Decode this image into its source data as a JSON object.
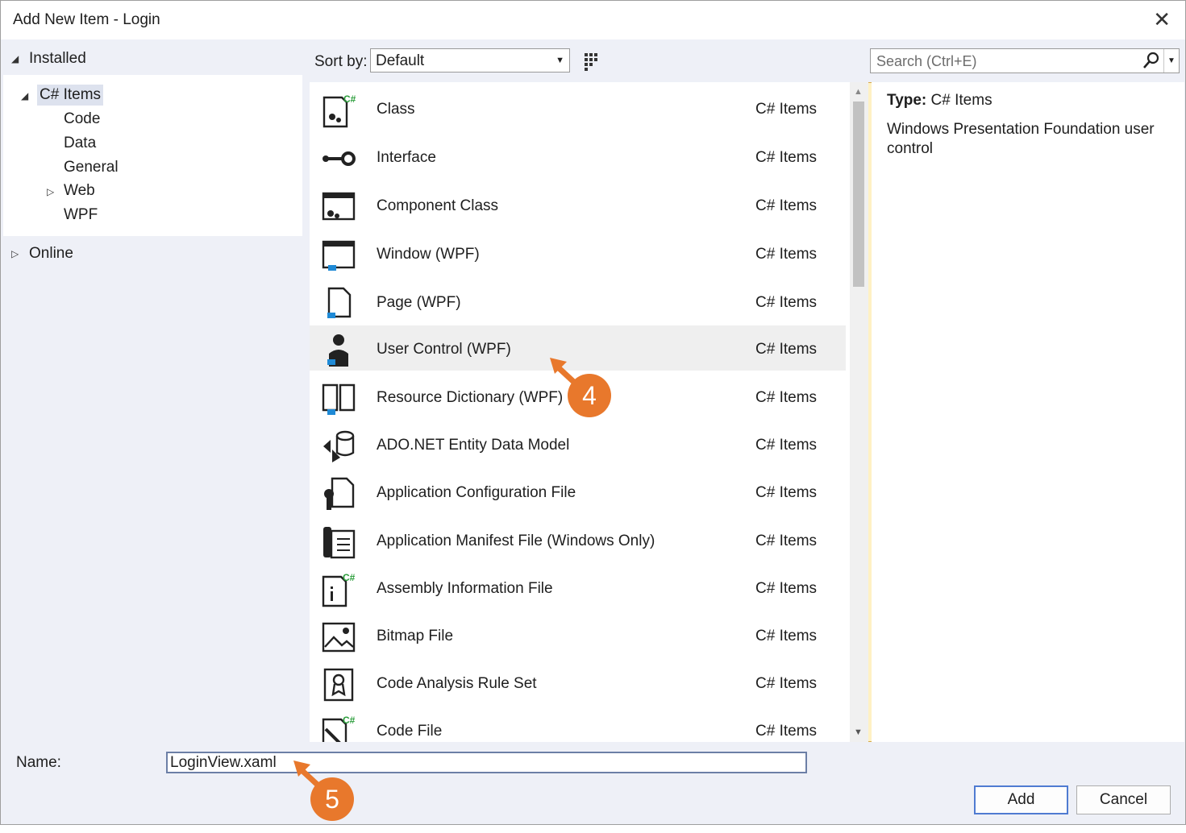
{
  "window": {
    "title": "Add New Item - Login",
    "close_glyph": "✕"
  },
  "tree": {
    "installed": "Installed",
    "csharp_items": "C# Items",
    "children": [
      "Code",
      "Data",
      "General",
      "Web",
      "WPF"
    ],
    "online": "Online"
  },
  "toolbar": {
    "sort_label": "Sort by:",
    "sort_value": "Default",
    "search_placeholder": "Search (Ctrl+E)"
  },
  "items": [
    {
      "name": "Class",
      "category": "C# Items",
      "icon": "class-icon"
    },
    {
      "name": "Interface",
      "category": "C# Items",
      "icon": "interface-icon"
    },
    {
      "name": "Component Class",
      "category": "C# Items",
      "icon": "component-icon"
    },
    {
      "name": "Window (WPF)",
      "category": "C# Items",
      "icon": "window-icon"
    },
    {
      "name": "Page (WPF)",
      "category": "C# Items",
      "icon": "page-icon"
    },
    {
      "name": "User Control (WPF)",
      "category": "C# Items",
      "icon": "user-control-icon",
      "selected": true
    },
    {
      "name": "Resource Dictionary (WPF)",
      "category": "C# Items",
      "icon": "resource-dictionary-icon"
    },
    {
      "name": "ADO.NET Entity Data Model",
      "category": "C# Items",
      "icon": "entity-model-icon"
    },
    {
      "name": "Application Configuration File",
      "category": "C# Items",
      "icon": "config-file-icon"
    },
    {
      "name": "Application Manifest File (Windows Only)",
      "category": "C# Items",
      "icon": "manifest-icon"
    },
    {
      "name": "Assembly Information File",
      "category": "C# Items",
      "icon": "assembly-info-icon"
    },
    {
      "name": "Bitmap File",
      "category": "C# Items",
      "icon": "bitmap-icon"
    },
    {
      "name": "Code Analysis Rule Set",
      "category": "C# Items",
      "icon": "rule-set-icon"
    },
    {
      "name": "Code File",
      "category": "C# Items",
      "icon": "code-file-icon"
    }
  ],
  "details": {
    "type_label": "Type:",
    "type_value": "C# Items",
    "description": "Windows Presentation Foundation user control"
  },
  "bottom": {
    "name_label": "Name:",
    "name_value": "LoginView.xaml",
    "add_label": "Add",
    "cancel_label": "Cancel"
  },
  "callouts": {
    "first": "4",
    "second": "5"
  },
  "colors": {
    "accent": "#e8782c",
    "selection": "#efefef",
    "list_view_active": "#fff1c4"
  }
}
